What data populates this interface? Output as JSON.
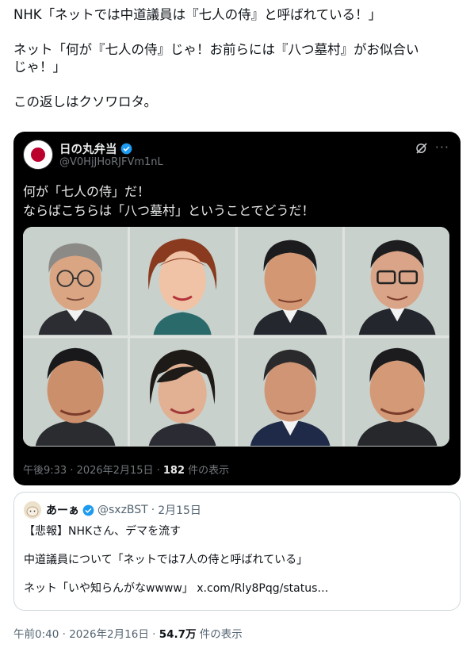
{
  "tweet": {
    "lines": [
      "NHK「ネットでは中道議員は『七人の侍』と呼ばれている！」",
      "ネット「何が『七人の侍』じゃ！お前らには『八つ墓村』がお似合い\nじゃ！」",
      "この返しはクソワロタ。"
    ]
  },
  "embed": {
    "name": "日の丸弁当",
    "handle": "@V0HjJHoRJFVm1nL",
    "text_line1": "何が「七人の侍」だ！",
    "text_line2": "ならばこちらは「八つ墓村」ということでどうだ！",
    "time": "午後9:33 · 2026年2月15日 · ",
    "views": "182",
    "views_label": " 件の表示",
    "avatar_icon": "japan-flag-icon",
    "colors": {
      "background": "#000000",
      "sun": "#bc002d"
    }
  },
  "quote": {
    "name": "あーぁ",
    "handle": "@sxzBST",
    "dot": "·",
    "date": "2月15日",
    "line1": "【悲報】NHKさん、デマを流す",
    "line2": "中道議員について「ネットでは7人の侍と呼ばれている」",
    "line3_prefix": "ネット「いや知らんがなwwww」 ",
    "line3_link": "x.com/Rly8Pqg/status…"
  },
  "footer": {
    "time": "午前0:40 · 2026年2月16日 · ",
    "views": "54.7万",
    "views_label": " 件の表示"
  }
}
